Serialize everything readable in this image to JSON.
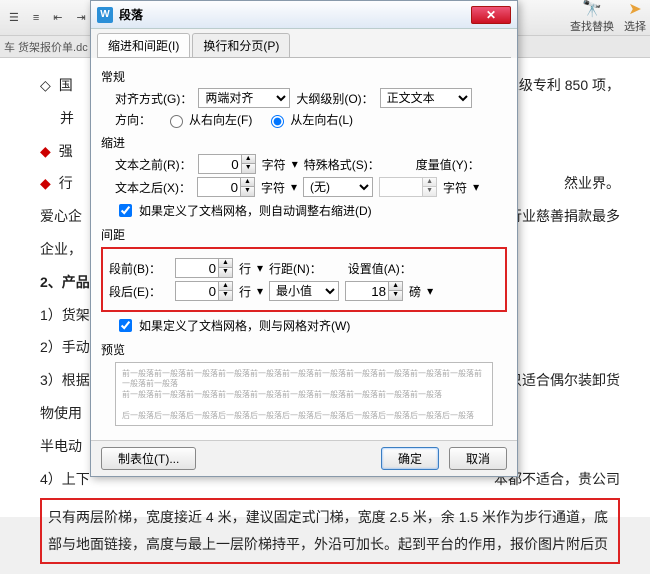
{
  "ribbon": {
    "find_replace_label": "查找替换",
    "select_label": "选择"
  },
  "doc_tab": "车 货架报价单.dc",
  "doc": {
    "l1": "国",
    "l1_tail": "国家级专利 850 项，",
    "l2": "并",
    "l3": "强",
    "l4": "行",
    "l4_tail": "然业界。",
    "l5": "爱心企",
    "l5_tail": "间行业慈善捐款最多",
    "l6": "企业，",
    "l7": "2、产品",
    "i1": "1）货架",
    "i2": "2）手动",
    "i3": "3）根据",
    "i3_tail": "只适合偶尔装卸货",
    "i4": "物使用",
    "i5": "半电动",
    "i6": "4）上下",
    "i6_tail": "本都不适合，贵公司",
    "para": "只有两层阶梯，宽度接近 4 米，建议固定式门梯，宽度 2.5 米，余 1.5 米作为步行通道，底部与地面链接，高度与最上一层阶梯持平，外沿可加长。起到平台的作用，报价图片附后页"
  },
  "dialog": {
    "title": "段落",
    "tab1": "缩进和间距(I)",
    "tab2": "换行和分页(P)",
    "section_general": "常规",
    "align_label": "对齐方式(G)：",
    "align_value": "两端对齐",
    "outline_label": "大纲级别(O)：",
    "outline_value": "正文文本",
    "direction_label": "方向：",
    "direction_rtl": "从右向左(F)",
    "direction_ltr": "从左向右(L)",
    "section_indent": "缩进",
    "before_text_label": "文本之前(R)：",
    "before_text_value": "0",
    "unit_char": "字符",
    "special_label": "特殊格式(S)：",
    "special_value": "(无)",
    "measure_label": "度量值(Y)：",
    "after_text_label": "文本之后(X)：",
    "after_text_value": "0",
    "auto_indent_chk": "如果定义了文档网格，则自动调整右缩进(D)",
    "section_spacing": "间距",
    "before_para_label": "段前(B)：",
    "before_para_value": "0",
    "unit_line": "行",
    "line_spacing_label": "行距(N)：",
    "line_spacing_value": "最小值",
    "set_value_label": "设置值(A)：",
    "set_value": "18",
    "unit_pt": "磅",
    "after_para_label": "段后(E)：",
    "after_para_value": "0",
    "grid_align_chk": "如果定义了文档网格，则与网格对齐(W)",
    "section_preview": "预览",
    "tabstops_btn": "制表位(T)...",
    "ok_btn": "确定",
    "cancel_btn": "取消"
  }
}
